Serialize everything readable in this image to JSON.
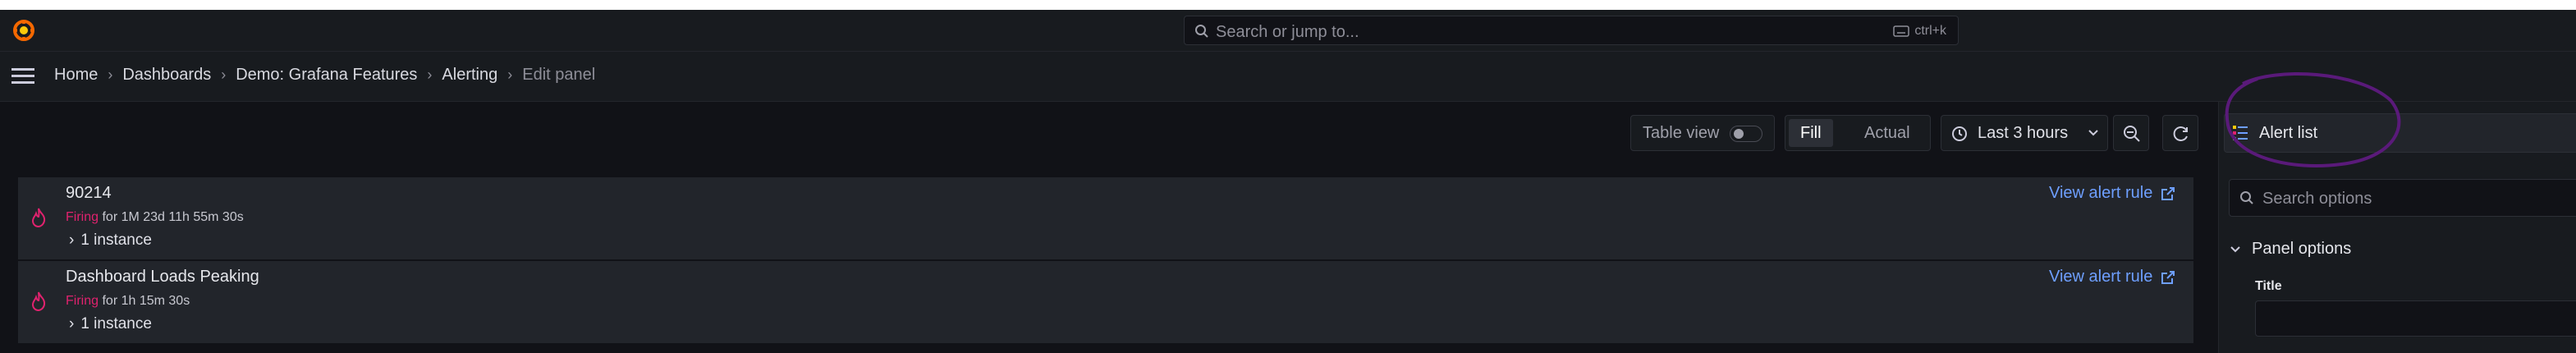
{
  "topbar": {
    "search_placeholder": "Search or jump to...",
    "search_shortcut": "ctrl+k",
    "logo_icon": "grafana-logo"
  },
  "breadcrumb": {
    "items": [
      "Home",
      "Dashboards",
      "Demo: Grafana Features",
      "Alerting"
    ],
    "current": "Edit panel"
  },
  "toolbar": {
    "table_view_label": "Table view",
    "table_view_on": false,
    "fill_label": "Fill",
    "actual_label": "Actual",
    "time_range": "Last 3 hours"
  },
  "alerts": [
    {
      "name": "90214",
      "state": "Firing",
      "duration": "for 1M 23d 11h 55m 30s",
      "instances": "1 instance",
      "link": "View alert rule"
    },
    {
      "name": "Dashboard Loads Peaking",
      "state": "Firing",
      "duration": "for 1h 15m 30s",
      "instances": "1 instance",
      "link": "View alert rule"
    }
  ],
  "options_pane": {
    "visualization": "Alert list",
    "search_placeholder": "Search options",
    "section_title": "Panel options",
    "title_field_label": "Title",
    "title_field_value": ""
  },
  "colors": {
    "background": "#111217",
    "panel": "#22252b",
    "firing": "#e0226e",
    "link": "#6e9fff",
    "annotation": "#5a1a7a"
  }
}
